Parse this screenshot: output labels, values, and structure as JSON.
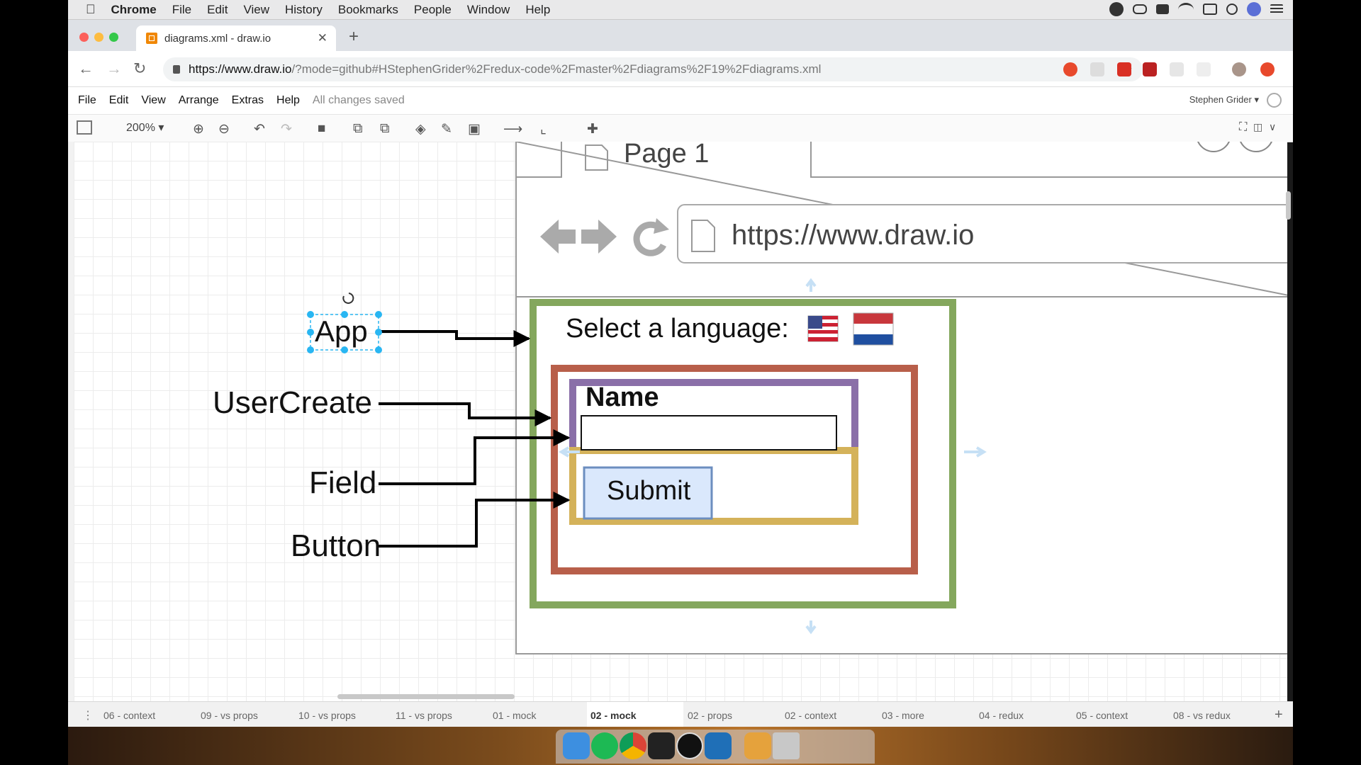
{
  "menubar": {
    "app_name": "Chrome",
    "items": [
      "File",
      "Edit",
      "View",
      "History",
      "Bookmarks",
      "People",
      "Window",
      "Help"
    ]
  },
  "browser": {
    "tab_title": "diagrams.xml - draw.io",
    "url_host": "https://www.draw.io",
    "url_path": "/?mode=github#HStephenGrider%2Fredux-code%2Fmaster%2Fdiagrams%2F19%2Fdiagrams.xml"
  },
  "app": {
    "menu": [
      "File",
      "Edit",
      "View",
      "Arrange",
      "Extras",
      "Help"
    ],
    "save_status": "All changes saved",
    "user_name": "Stephen Grider",
    "zoom_level": "200%"
  },
  "diagram": {
    "labels": {
      "app": "App",
      "user_create": "UserCreate",
      "field": "Field",
      "button": "Button"
    },
    "mock": {
      "page_tab": "Page 1",
      "url": "https://www.draw.io",
      "select_language": "Select a language:",
      "name_label": "Name",
      "submit_label": "Submit"
    },
    "colors": {
      "app_box": "#84a75d",
      "usercreate_box": "#b85f4a",
      "field_box": "#8a6fa8",
      "button_box": "#d4b25a",
      "submit_fill": "#dae8fc",
      "selection": "#29b6f2"
    }
  },
  "page_tabs": [
    {
      "label": "06 - context"
    },
    {
      "label": "09 - vs props"
    },
    {
      "label": "10 - vs props"
    },
    {
      "label": "11 - vs props"
    },
    {
      "label": "01 - mock"
    },
    {
      "label": "02 - mock",
      "active": true
    },
    {
      "label": "02 - props"
    },
    {
      "label": "02 - context"
    },
    {
      "label": "03 - more"
    },
    {
      "label": "04 - redux"
    },
    {
      "label": "05 - context"
    },
    {
      "label": "08 - vs redux"
    }
  ]
}
